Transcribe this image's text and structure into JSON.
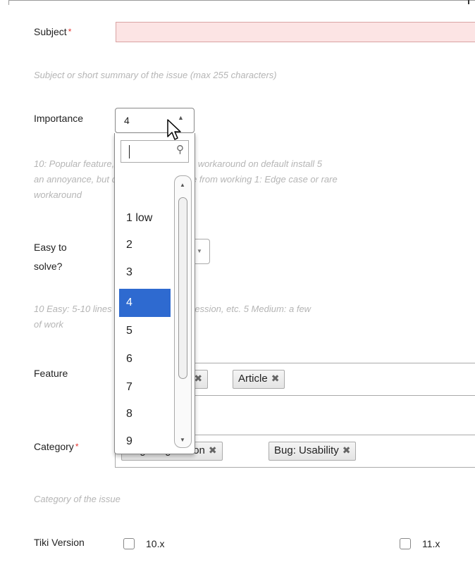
{
  "subject": {
    "label": "Subject",
    "required_mark": "*",
    "value": "",
    "help": "Subject or short summary of the issue (max 255 characters)"
  },
  "importance": {
    "label": "Importance",
    "selected": "4",
    "help_line1": "10: Popular feature, severe problem, no workaround on default install 5",
    "help_line2": "an annoyance, but does not stop people from working 1: Edge case or rare",
    "help_line3": "workaround"
  },
  "importance_dropdown": {
    "search_value": "",
    "options": [
      "1 low",
      "2",
      "3",
      "4",
      "5",
      "6",
      "7",
      "8",
      "9"
    ],
    "selected_index": 3
  },
  "easy": {
    "label_line1": "Easy to",
    "label_line2": "solve?",
    "help_line1": "10 Easy: 5-10 lines of fix, no risk of regression, etc. 5 Medium: a few",
    "help_line2": "of work"
  },
  "feature": {
    "label": "Feature",
    "tokens": [
      {
        "label": "g",
        "remove": "✖"
      },
      {
        "label": "Article",
        "remove": "✖"
      }
    ]
  },
  "category": {
    "label": "Category",
    "required_mark": "*",
    "tokens": [
      {
        "label": "Bug: Regression",
        "remove": "✖"
      },
      {
        "label": "Bug: Usability",
        "remove": "✖"
      }
    ],
    "help": "Category of the issue"
  },
  "tiki_version": {
    "label": "Tiki Version",
    "options": [
      {
        "label": "10.x",
        "checked": false
      },
      {
        "label": "11.x",
        "checked": false
      }
    ]
  },
  "colors": {
    "selected_option": "#2e6ad0",
    "required": "#e5322d",
    "invalid_field": "#fce4e4",
    "help_text": "#b5b5b5"
  },
  "icons": [
    "search-icon",
    "chevron-up-icon",
    "chevron-down-icon",
    "remove-icon",
    "mouse-pointer-icon"
  ]
}
